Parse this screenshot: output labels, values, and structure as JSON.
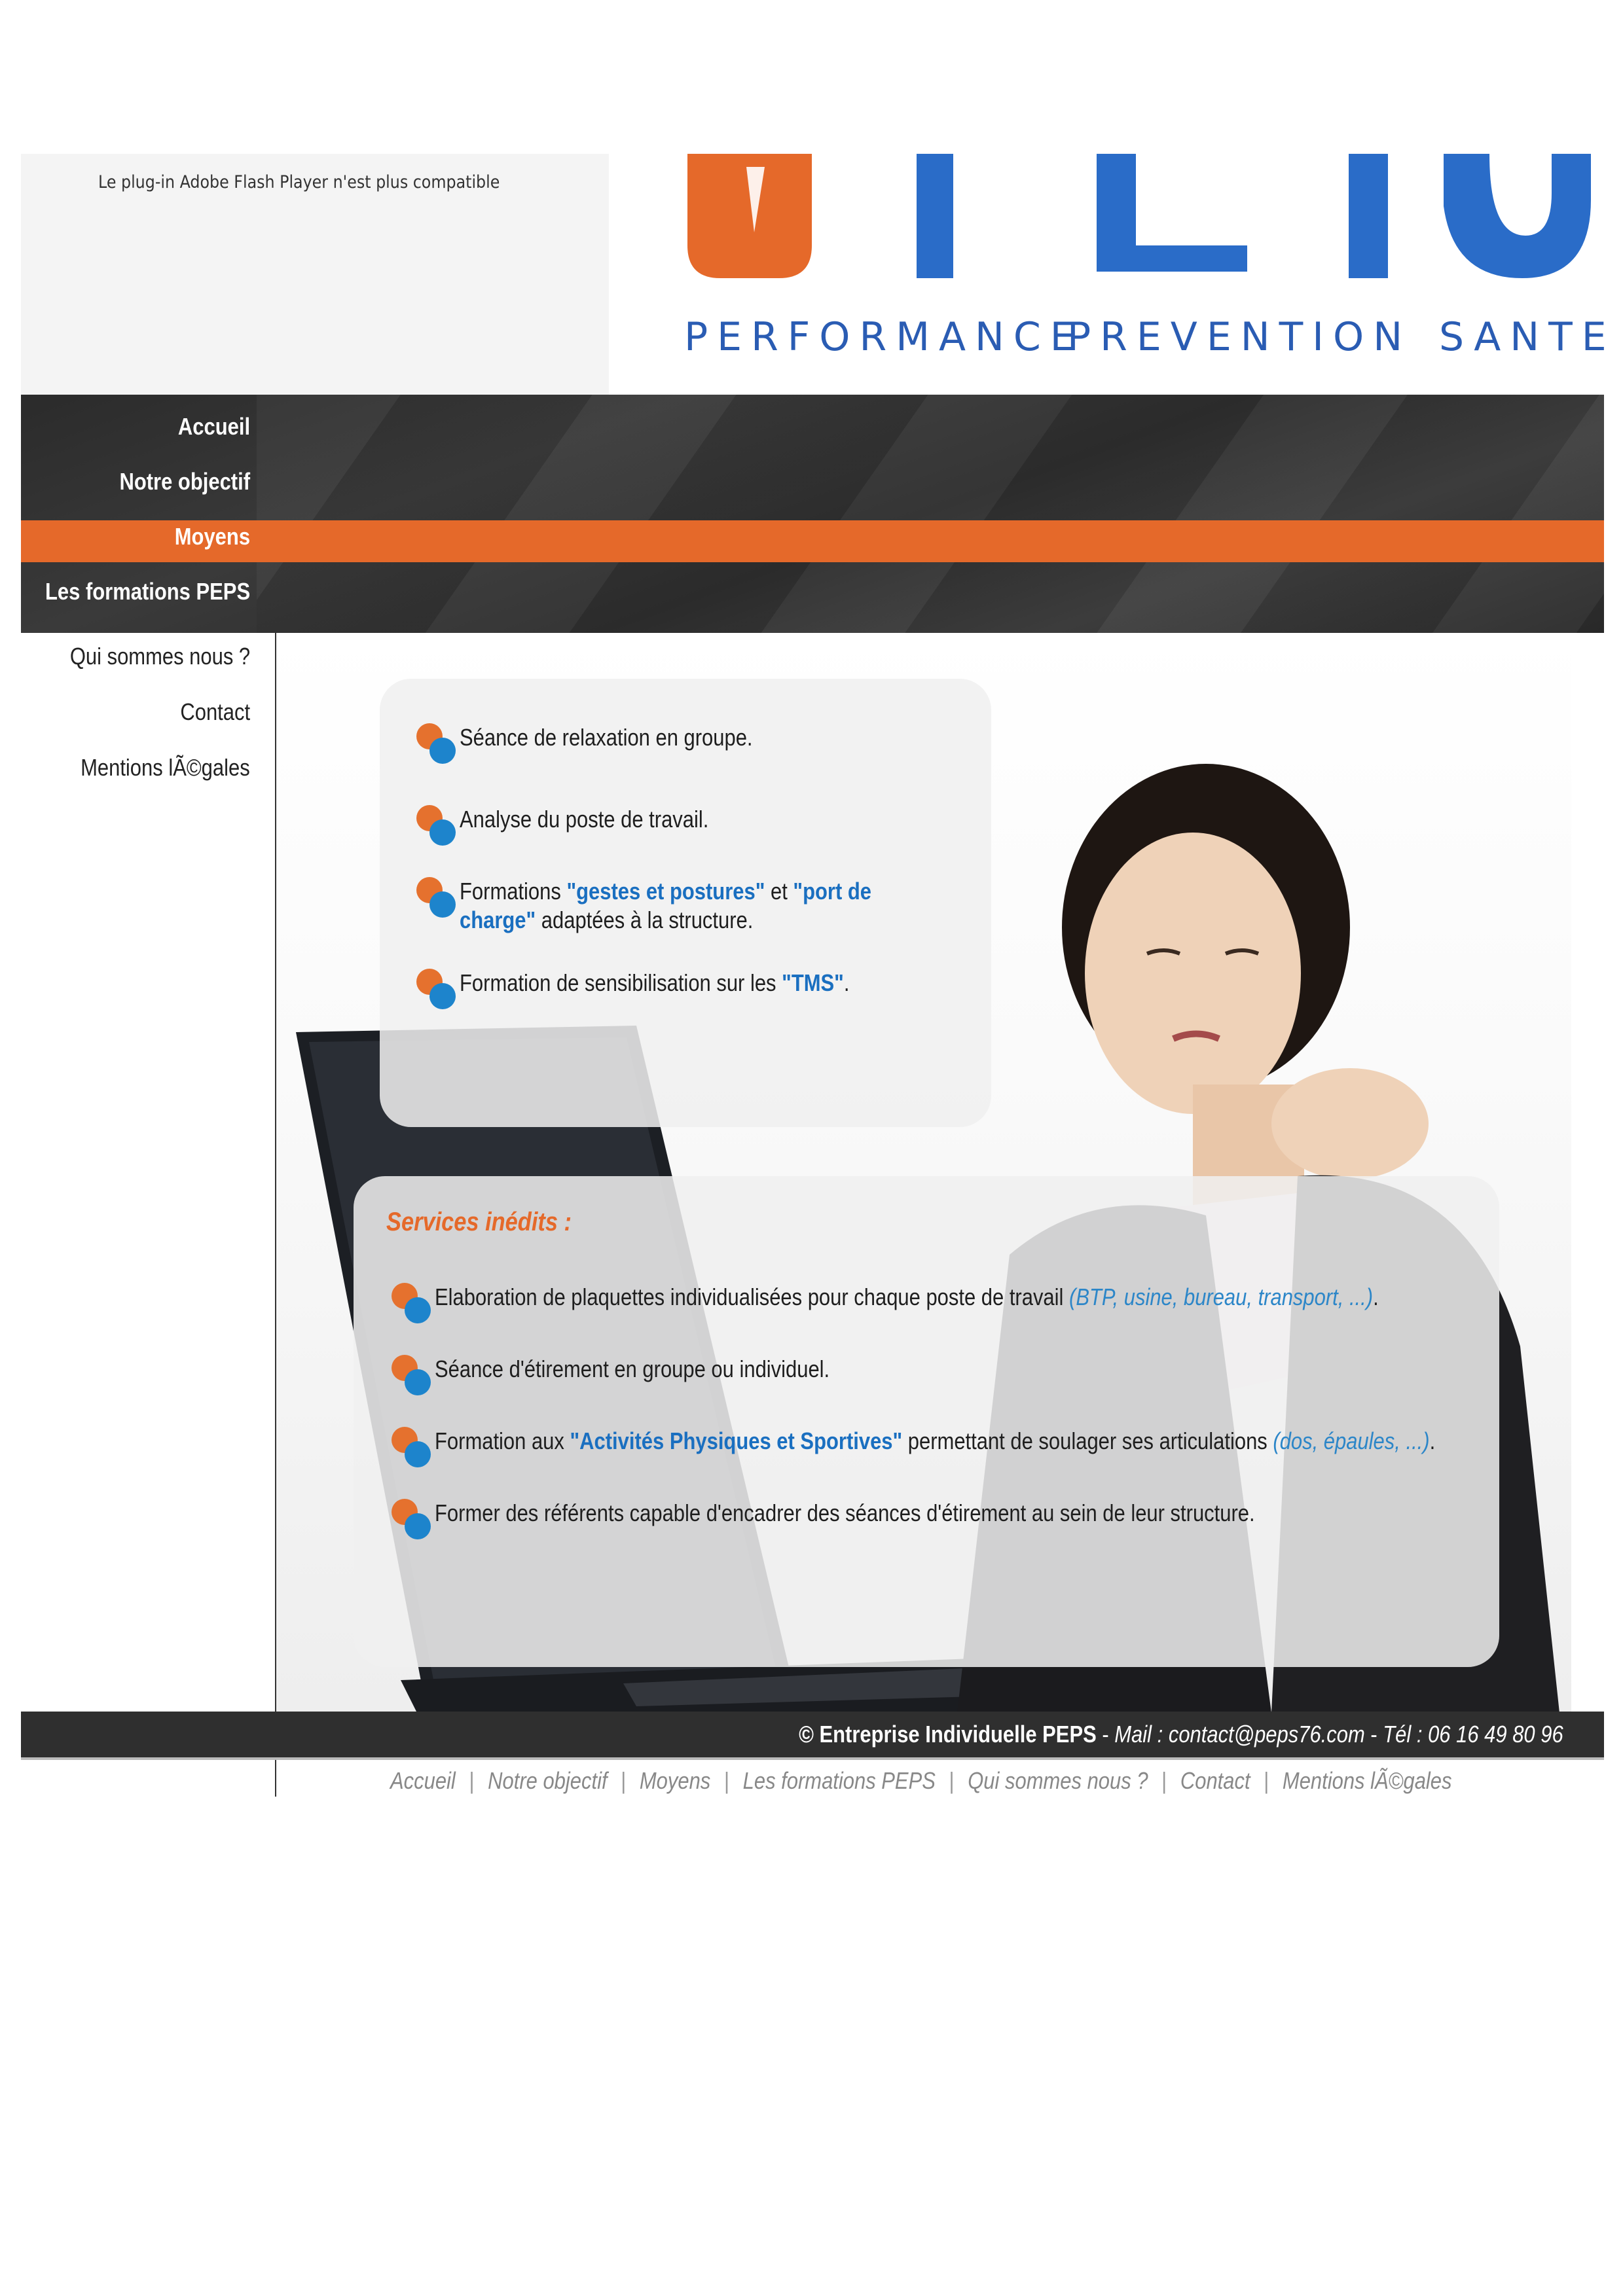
{
  "header": {
    "flash_message": "Le plug-in Adobe Flash Player n'est plus compatible",
    "logo_text": "PEPS",
    "tagline": [
      "PERFORMANCE",
      "PREVENTION",
      "SANTE"
    ]
  },
  "nav": {
    "items": [
      {
        "label": "Accueil"
      },
      {
        "label": "Notre objectif"
      },
      {
        "label": "Moyens",
        "active": true
      },
      {
        "label": "Les formations PEPS"
      },
      {
        "label": "Qui sommes nous ?"
      },
      {
        "label": "Contact"
      },
      {
        "label": "Mentions lÃ©gales"
      }
    ]
  },
  "panel1": {
    "items": [
      {
        "text": "Séance de relaxation en groupe."
      },
      {
        "text": "Analyse du poste de travail."
      },
      {
        "pre": "Formations ",
        "hl1": "\"gestes et postures\"",
        "mid": " et ",
        "hl2a": "\"port de",
        "hl2b": "charge\"",
        "post": " adaptées à la structure."
      },
      {
        "pre": "Formation de sensibilisation sur les ",
        "hl": "\"TMS\"",
        "post": "."
      }
    ]
  },
  "panel2": {
    "title": "Services inédits :",
    "items": [
      {
        "pre": "Elaboration de plaquettes individualisées pour chaque poste de travail ",
        "it": "(BTP, usine, bureau, transport, ...)",
        "post": "."
      },
      {
        "text": "Séance d'étirement en groupe ou individuel."
      },
      {
        "pre": "Formation aux ",
        "hl": "\"Activités Physiques et Sportives\"",
        "mid": " permettant de soulager ses articulations ",
        "it": "(dos, épaules, ...)",
        "post": "."
      },
      {
        "text": "Former des référents capable d'encadrer des séances d'étirement au sein de leur structure."
      }
    ]
  },
  "footer": {
    "company": "© Entreprise Individuelle PEPS",
    "sep": " - ",
    "mail": "Mail : contact@peps76.com",
    "phone": "Tél : 06 16 49 80 96",
    "links": [
      "Accueil",
      "Notre objectif",
      "Moyens",
      "Les formations PEPS",
      "Qui sommes nous ?",
      "Contact",
      "Mentions lÃ©gales"
    ]
  },
  "colors": {
    "accent_orange": "#e5692a",
    "brand_blue": "#2a6cc8",
    "nav_dark": "#2f2f2f"
  }
}
